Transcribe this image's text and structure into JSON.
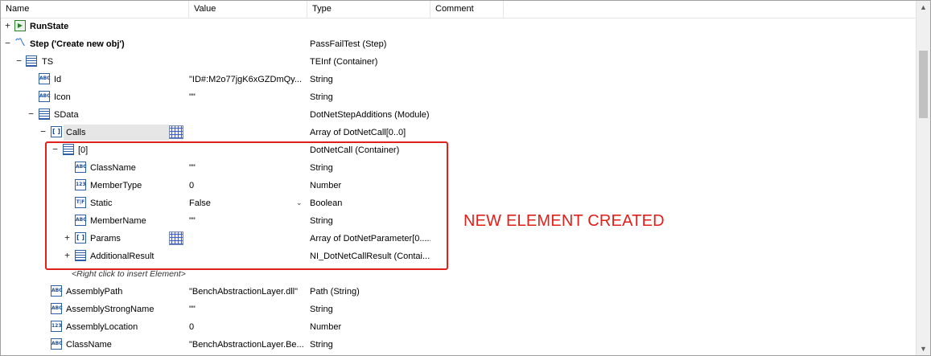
{
  "columns": [
    "Name",
    "Value",
    "Type",
    "Comment"
  ],
  "rows": [
    {
      "name": "RunState",
      "value": "",
      "type": "",
      "bold": true,
      "expander": "+",
      "icon": "runstate-icon",
      "glyph": "▶"
    },
    {
      "name": "Step ('Create new obj')",
      "value": "",
      "type": "PassFailTest (Step)",
      "bold": true,
      "expander": "−",
      "icon": "step-icon",
      "glyph": "〽"
    },
    {
      "name": "TS",
      "value": "",
      "type": "TEInf (Container)",
      "expander": "−",
      "icon": "container-icon",
      "glyph": ""
    },
    {
      "name": "Id",
      "value": "\"ID#:M2o77jgK6xGZDmQy...",
      "type": "String",
      "icon": "string-icon",
      "glyph": "ABC"
    },
    {
      "name": "Icon",
      "value": "\"\"",
      "type": "String",
      "icon": "string-icon",
      "glyph": "ABC"
    },
    {
      "name": "SData",
      "value": "",
      "type": "DotNetStepAdditions (Module)",
      "expander": "−",
      "icon": "container-icon",
      "glyph": ""
    },
    {
      "name": "Calls",
      "value": "",
      "type": "Array of DotNetCall[0..0]",
      "expander": "−",
      "icon": "array-icon",
      "glyph": "[ ]",
      "gridbtn": true,
      "selected": true
    },
    {
      "name": "[0]",
      "value": "",
      "type": "DotNetCall (Container)",
      "expander": "−",
      "icon": "container-icon",
      "glyph": ""
    },
    {
      "name": "ClassName",
      "value": "\"\"",
      "type": "String",
      "icon": "string-icon",
      "glyph": "ABC"
    },
    {
      "name": "MemberType",
      "value": "0",
      "type": "Number",
      "icon": "number-icon",
      "glyph": "123"
    },
    {
      "name": "Static",
      "value": "False",
      "type": "Boolean",
      "icon": "boolean-icon",
      "glyph": "T|F",
      "dropdown": true
    },
    {
      "name": "MemberName",
      "value": "\"\"",
      "type": "String",
      "icon": "string-icon",
      "glyph": "ABC"
    },
    {
      "name": "Params",
      "value": "",
      "type": "Array of DotNetParameter[0.....",
      "expander": "+",
      "icon": "array-icon",
      "glyph": "[ ]",
      "gridbtn": true
    },
    {
      "name": "AdditionalResult",
      "value": "",
      "type": "NI_DotNetCallResult (Contai...",
      "expander": "+",
      "icon": "container-icon",
      "glyph": ""
    },
    {
      "hint": "<Right click to insert Element>"
    },
    {
      "name": "AssemblyPath",
      "value": "\"BenchAbstractionLayer.dll\"",
      "type": "Path (String)",
      "icon": "string-icon",
      "glyph": "ABC"
    },
    {
      "name": "AssemblyStrongName",
      "value": "\"\"",
      "type": "String",
      "icon": "string-icon",
      "glyph": "ABC"
    },
    {
      "name": "AssemblyLocation",
      "value": "0",
      "type": "Number",
      "icon": "number-icon",
      "glyph": "123"
    },
    {
      "name": "ClassName",
      "value": "\"BenchAbstractionLayer.Be...",
      "type": "String",
      "icon": "string-icon",
      "glyph": "ABC"
    }
  ],
  "annotation": "NEW ELEMENT CREATED",
  "scroll_up": "▲",
  "scroll_down": "▼",
  "dropdown_glyph": "⌄",
  "colors": {
    "highlight": "#e0201a",
    "icon_blue": "#2f5ea8"
  }
}
